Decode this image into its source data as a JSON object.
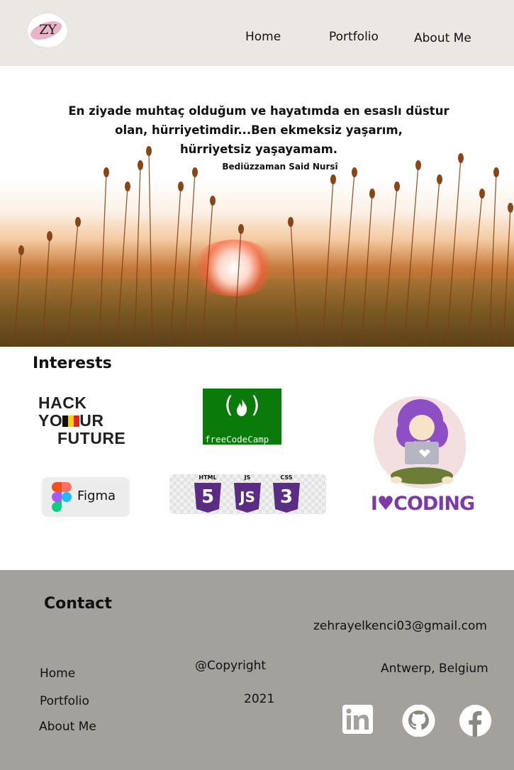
{
  "header": {
    "logo_text": "ZY",
    "nav": [
      {
        "label": "Home"
      },
      {
        "label": "Portfolio"
      },
      {
        "label": "About Me"
      }
    ]
  },
  "hero": {
    "quote": "En ziyade muhtaç olduğum ve hayatımda en esaslı düstur olan, hürriyetimdir...Ben ekmeksiz yaşarım, hürriyetsiz yaşayamam.",
    "quote_lines": [
      "En ziyade muhtaç olduğum ve hayatımda en esaslı düstur",
      "olan, hürriyetimdir...Ben ekmeksiz yaşarım,",
      "hürriyetsiz yaşayamam."
    ],
    "author": "Bediüzzaman Said Nursî"
  },
  "interests": {
    "title": "Interests",
    "hyf": {
      "line1": "HACK",
      "line2a": "YO",
      "line2b": "UR",
      "line3": "FUTURE"
    },
    "fcc": {
      "mark": "(   )",
      "name": "freeCodeCamp"
    },
    "figma": {
      "name": "Figma"
    },
    "webtech": {
      "badges": [
        {
          "label": "HTML",
          "num": "5"
        },
        {
          "label": "JS",
          "num": "JS"
        },
        {
          "label": "CSS",
          "num": "3"
        }
      ]
    },
    "coding": {
      "text": "I♥CODING"
    }
  },
  "footer": {
    "title": "Contact",
    "email": "zehrayelkenci03@gmail.com",
    "location": "Antwerp, Belgium",
    "copyright": "@Copyright",
    "year": "2021",
    "links": [
      {
        "label": "Home"
      },
      {
        "label": "Portfolio"
      },
      {
        "label": "About Me"
      }
    ],
    "social": [
      "linkedin-icon",
      "github-icon",
      "facebook-icon"
    ]
  },
  "colors": {
    "header_bg": "#ebe8e3",
    "footer_bg": "#a3a19c",
    "fcc_green": "#0a7a0a",
    "purple": "#5b2c83",
    "coding_purple": "#7b3aa6"
  }
}
